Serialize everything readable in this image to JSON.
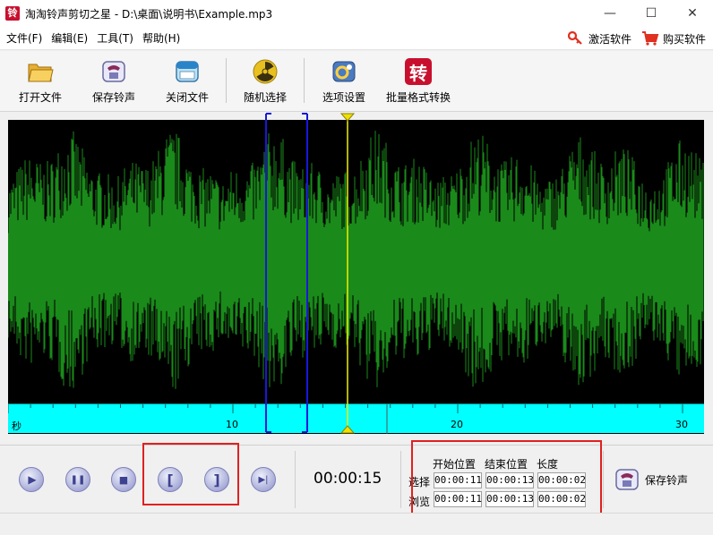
{
  "window": {
    "title": "淘淘铃声剪切之星 - D:\\桌面\\说明书\\Example.mp3",
    "app_icon": "铃",
    "minimize": "—",
    "maximize": "☐",
    "close": "✕"
  },
  "menu": {
    "items": [
      "文件(F)",
      "编辑(E)",
      "工具(T)",
      "帮助(H)"
    ],
    "activate_label": "激活软件",
    "buy_label": "购买软件"
  },
  "toolbar": {
    "open_label": "打开文件",
    "save_label": "保存铃声",
    "close_label": "关闭文件",
    "random_label": "随机选择",
    "options_label": "选项设置",
    "convert_label": "批量格式转换",
    "convert_icon_text": "转"
  },
  "timeline": {
    "unit_label": "秒",
    "ticks": [
      "10",
      "20",
      "30"
    ]
  },
  "waveform": {
    "color": "#1a8a1a",
    "background": "#000000",
    "cursor_color": "#ffff00",
    "selection_color": "#0000ff"
  },
  "controls": {
    "play_icon": "▶",
    "pause_icon": "❚❚",
    "stop_icon": "■",
    "mark_start_icon": "[",
    "mark_end_icon": "]",
    "next_icon": "▶|",
    "current_time": "00:00:15"
  },
  "positions": {
    "header_start": "开始位置",
    "header_end": "结束位置",
    "header_length": "长度",
    "select_label": "选择",
    "preview_label": "浏览",
    "select_start": "00:00:11",
    "select_end": "00:00:13",
    "select_length": "00:00:02",
    "preview_start": "00:00:11",
    "preview_end": "00:00:13",
    "preview_length": "00:00:02"
  },
  "save_ringtone_label": "保存铃声"
}
